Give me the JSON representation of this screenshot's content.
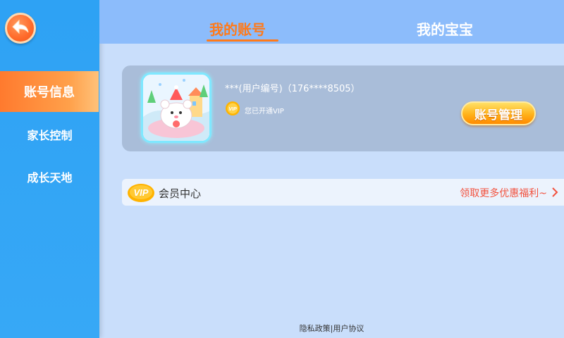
{
  "sidebar": {
    "items": [
      {
        "label": "账号信息",
        "active": true
      },
      {
        "label": "家长控制",
        "active": false
      },
      {
        "label": "成长天地",
        "active": false
      }
    ]
  },
  "tabs": [
    {
      "label": "我的账号",
      "active": true
    },
    {
      "label": "我的宝宝",
      "active": false
    }
  ],
  "profile": {
    "user_id": "***(用户编号)（176****8505）",
    "vip_badge": "VIP",
    "vip_status": "您已开通VIP",
    "manage_label": "账号管理"
  },
  "member": {
    "badge": "VIP",
    "label": "会员中心",
    "promo": "领取更多优惠福利~"
  },
  "footer": {
    "links": "隐私政策|用户协议"
  },
  "colors": {
    "accent": "#ff7a1a",
    "sidebar": "#2ea2f4",
    "promo": "#f2523e"
  }
}
